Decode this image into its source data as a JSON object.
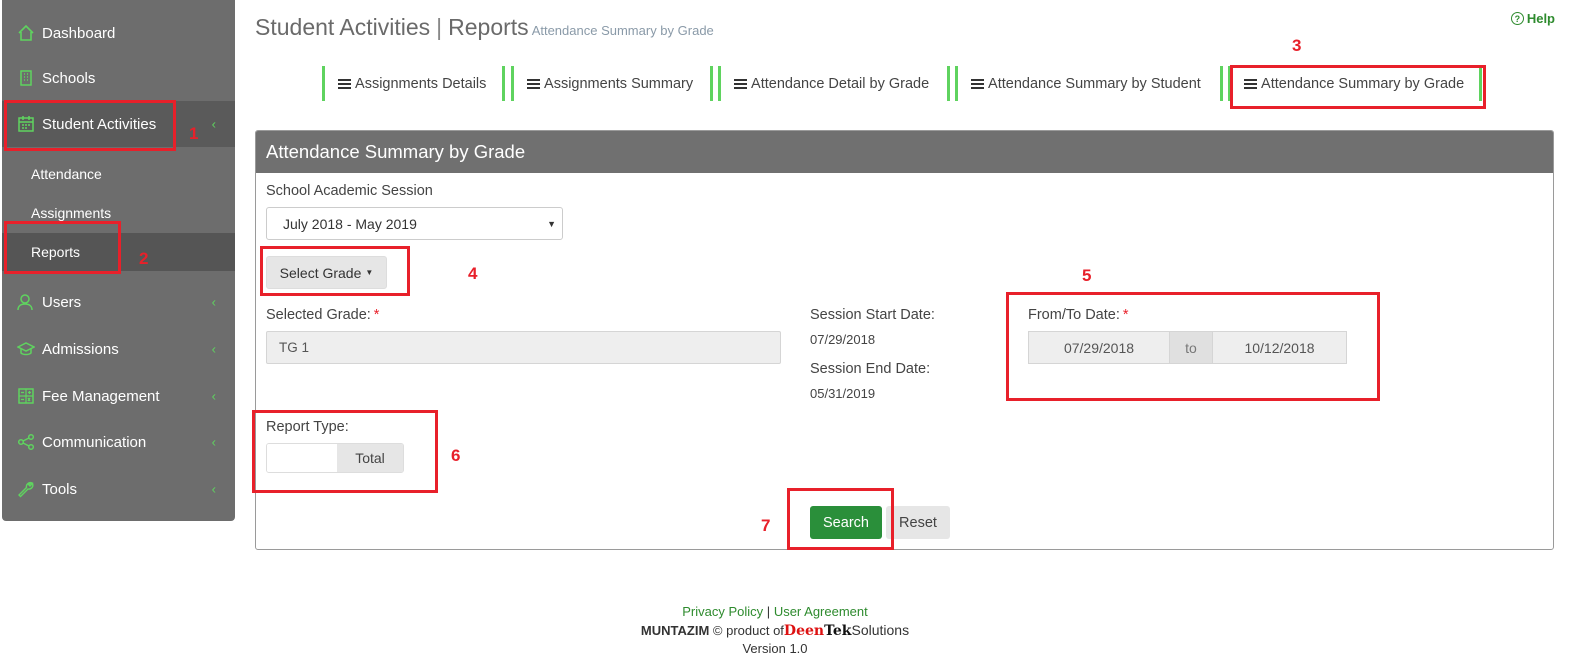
{
  "sidebar": {
    "items": [
      {
        "label": "Dashboard",
        "icon": "home-icon"
      },
      {
        "label": "Schools",
        "icon": "building-icon"
      },
      {
        "label": "Student Activities",
        "icon": "calendar-icon"
      },
      {
        "label": "Users",
        "icon": "user-icon"
      },
      {
        "label": "Admissions",
        "icon": "graduation-cap-icon"
      },
      {
        "label": "Fee Management",
        "icon": "calculator-icon"
      },
      {
        "label": "Communication",
        "icon": "share-icon"
      },
      {
        "label": "Tools",
        "icon": "wrench-icon"
      }
    ],
    "sub_items": [
      {
        "label": "Attendance"
      },
      {
        "label": "Assignments"
      },
      {
        "label": "Reports"
      }
    ],
    "chevron": "‹"
  },
  "header": {
    "title": "Student Activities",
    "separator": "|",
    "section": "Reports",
    "subtitle": "Attendance Summary by Grade",
    "help": "Help",
    "help_glyph": "?"
  },
  "tabs": [
    {
      "label": "Assignments Details"
    },
    {
      "label": "Assignments Summary"
    },
    {
      "label": "Attendance Detail by Grade"
    },
    {
      "label": "Attendance Summary by Student"
    },
    {
      "label": "Attendance Summary by Grade"
    }
  ],
  "panel": {
    "title": "Attendance Summary by Grade",
    "session_label": "School Academic Session",
    "session_value": "July 2018 - May 2019",
    "select_grade_label": "Select Grade",
    "selected_grade_label": "Selected Grade:",
    "selected_grade_value": "TG 1",
    "session_start_label": "Session Start Date:",
    "session_start_value": "07/29/2018",
    "session_end_label": "Session End Date:",
    "session_end_value": "05/31/2019",
    "from_to_label": "From/To Date:",
    "from_date": "07/29/2018",
    "to_word": "to",
    "to_date": "10/12/2018",
    "report_type_label": "Report Type:",
    "report_type_value": "Total",
    "required_mark": "*",
    "search_label": "Search",
    "reset_label": "Reset"
  },
  "annotations": [
    "1",
    "2",
    "3",
    "4",
    "5",
    "6",
    "7"
  ],
  "footer": {
    "privacy": "Privacy Policy",
    "sep": "|",
    "agreement": "User Agreement",
    "brand": "MUNTAZIM",
    "copy_text": "© product of",
    "company_part1": "Deen",
    "company_part2": "Tek",
    "company_part3": "Solutions",
    "version": "Version 1.0"
  },
  "colors": {
    "sidebar_bg": "#6d6d6d",
    "accent_green": "#5fd35f",
    "button_green": "#2a8f3a",
    "annotation_red": "#e8202a",
    "panel_header": "#707070"
  }
}
